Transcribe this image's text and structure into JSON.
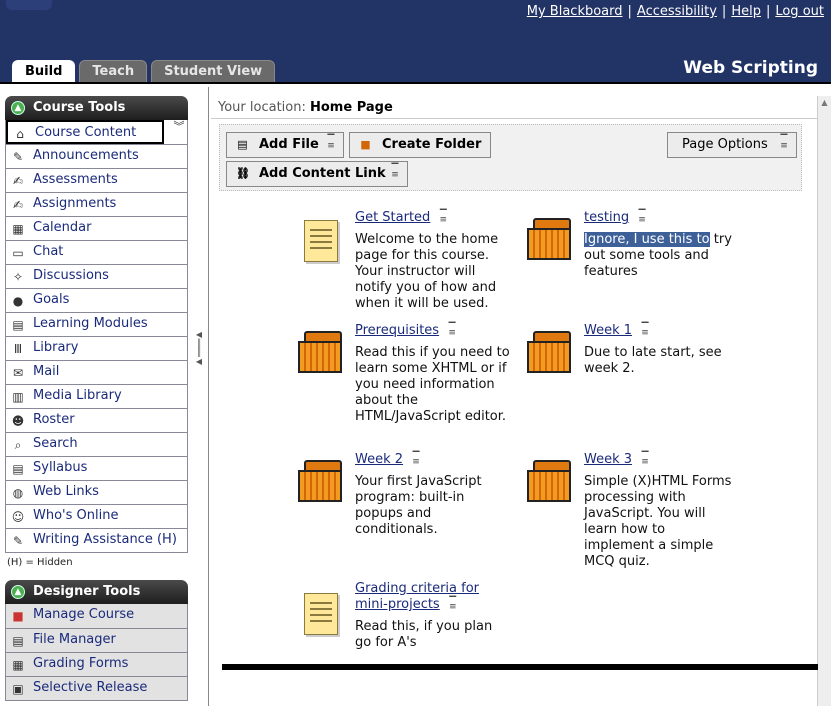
{
  "header": {
    "links": [
      "My Blackboard",
      "Accessibility",
      "Help",
      "Log out"
    ],
    "course_title": "Web Scripting",
    "tabs": [
      "Build",
      "Teach",
      "Student View"
    ]
  },
  "sidebar": {
    "course_tools_title": "Course Tools",
    "course_tools": [
      {
        "label": "Course Content",
        "icon": "house-icon"
      },
      {
        "label": "Announcements",
        "icon": "megaphone-icon"
      },
      {
        "label": "Assessments",
        "icon": "pencil-icon"
      },
      {
        "label": "Assignments",
        "icon": "pencil-icon"
      },
      {
        "label": "Calendar",
        "icon": "calendar-icon"
      },
      {
        "label": "Chat",
        "icon": "chat-icon"
      },
      {
        "label": "Discussions",
        "icon": "pin-icon"
      },
      {
        "label": "Goals",
        "icon": "goals-icon"
      },
      {
        "label": "Learning Modules",
        "icon": "modules-icon"
      },
      {
        "label": "Library",
        "icon": "library-icon"
      },
      {
        "label": "Mail",
        "icon": "mail-icon"
      },
      {
        "label": "Media Library",
        "icon": "media-icon"
      },
      {
        "label": "Roster",
        "icon": "roster-icon"
      },
      {
        "label": "Search",
        "icon": "search-icon"
      },
      {
        "label": "Syllabus",
        "icon": "syllabus-icon"
      },
      {
        "label": "Web Links",
        "icon": "globe-icon"
      },
      {
        "label": "Who's Online",
        "icon": "person-icon"
      },
      {
        "label": "Writing Assistance",
        "suffix": "(H)",
        "icon": "writing-icon"
      }
    ],
    "hidden_note": "(H) = Hidden",
    "designer_tools_title": "Designer Tools",
    "designer_tools": [
      {
        "label": "Manage Course",
        "icon": "manage-icon"
      },
      {
        "label": "File Manager",
        "icon": "files-icon"
      },
      {
        "label": "Grading Forms",
        "icon": "grading-icon"
      },
      {
        "label": "Selective Release",
        "icon": "release-icon"
      }
    ]
  },
  "main": {
    "location_label": "Your location:",
    "location_value": "Home Page",
    "toolbar": {
      "add_file": "Add File",
      "create_folder": "Create Folder",
      "add_content_link": "Add Content Link",
      "page_options": "Page Options"
    },
    "items": [
      {
        "title": "Get Started",
        "type": "file",
        "desc": "Welcome to the home page for this course. Your instructor will notify you of how and when it will be used."
      },
      {
        "title": "testing",
        "type": "folder",
        "desc_highlight": "Ignore, I use this to",
        "desc": "try out some tools and features"
      },
      {
        "title": "Prerequisites",
        "type": "folder",
        "desc": "Read this if you need to learn some XHTML or if you need information about the HTML/JavaScript editor."
      },
      {
        "title": "Week 1",
        "type": "folder",
        "desc": "Due to late start, see week 2."
      },
      {
        "title": "Week 2",
        "type": "folder",
        "desc": "Your first JavaScript program: built-in popups and conditionals."
      },
      {
        "title": "Week 3",
        "type": "folder",
        "desc": "Simple (X)HTML Forms processing with JavaScript. You will learn how to implement a simple MCQ quiz."
      },
      {
        "title": "Grading criteria for mini-projects",
        "type": "file",
        "desc": "Read this, if you plan go for A's"
      }
    ]
  }
}
